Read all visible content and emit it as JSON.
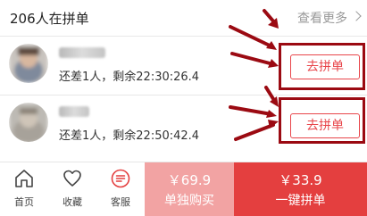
{
  "header": {
    "title": "206人在拼单",
    "more_label": "查看更多"
  },
  "group_rows": [
    {
      "countdown_text": "还差1人，剩余22:30:26.4",
      "join_label": "去拼单"
    },
    {
      "countdown_text": "还差1人，剩余22:50:42.4",
      "join_label": "去拼单"
    }
  ],
  "bottom_bar": {
    "nav": [
      {
        "label": "首页",
        "icon": "home-icon"
      },
      {
        "label": "收藏",
        "icon": "heart-icon"
      },
      {
        "label": "客服",
        "icon": "chat-icon"
      }
    ],
    "single_buy": {
      "price": "￥69.9",
      "label": "单独购买"
    },
    "group_buy": {
      "price": "￥33.9",
      "label": "一键拼单"
    }
  },
  "colors": {
    "accent_red": "#e43f3f",
    "light_red": "#f2a3a3",
    "annotation": "#9b0a12"
  }
}
